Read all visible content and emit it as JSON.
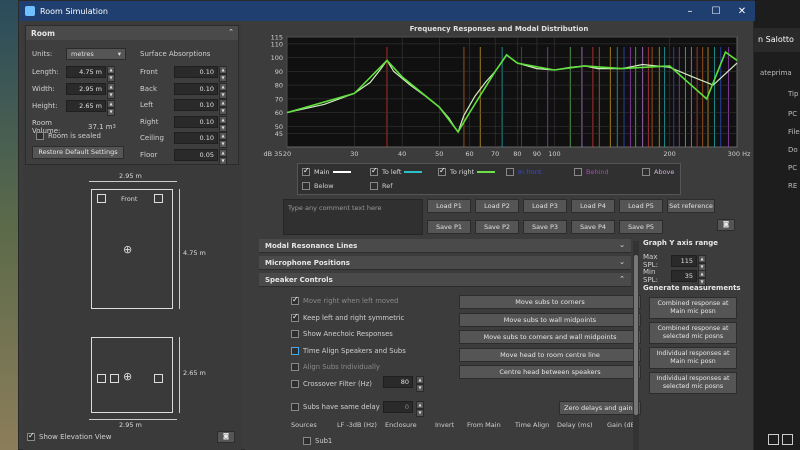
{
  "window": {
    "title": "Room Simulation",
    "buttons": [
      "–",
      "☐",
      "✕"
    ]
  },
  "background_app": {
    "tab": "n Salotto",
    "subtitle": "ateprima",
    "col": "Tip",
    "rows": [
      "PC",
      "File",
      "Do",
      "PC",
      "RE"
    ]
  },
  "room": {
    "section_title": "Room",
    "units_label": "Units:",
    "units_value": "metres",
    "length_label": "Length:",
    "length_value": "4.75 m",
    "width_label": "Width:",
    "width_value": "2.95 m",
    "height_label": "Height:",
    "height_value": "2.65 m",
    "volume_label": "Room Volume:",
    "volume_value": "37.1 m",
    "volume_unit_sup": "3",
    "sealed_label": "Room is sealed",
    "restore_button": "Restore Default Settings",
    "absorptions_title": "Surface Absorptions",
    "surfaces": [
      {
        "label": "Front",
        "value": "0.10"
      },
      {
        "label": "Back",
        "value": "0.10"
      },
      {
        "label": "Left",
        "value": "0.10"
      },
      {
        "label": "Right",
        "value": "0.10"
      },
      {
        "label": "Ceiling",
        "value": "0.10"
      },
      {
        "label": "Floor",
        "value": "0.05"
      }
    ]
  },
  "plan": {
    "top_width": "2.95 m",
    "front_label": "Front",
    "length": "4.75 m",
    "height": "2.65 m",
    "bottom_width": "2.95 m",
    "elevation_label": "Show Elevation View"
  },
  "chart": {
    "title": "Frequency Responses and Modal Distribution",
    "y_unit": "dB 35",
    "x_unit": "300 Hz",
    "y_ticks": [
      "115",
      "110",
      "100",
      "90",
      "80",
      "70",
      "60",
      "50",
      "45"
    ],
    "x_ticks": [
      "20",
      "30",
      "40",
      "50",
      "60",
      "70",
      "80",
      "90",
      "100",
      "200"
    ]
  },
  "chart_data": {
    "type": "line",
    "title": "Frequency Responses and Modal Distribution",
    "xlabel": "Hz",
    "ylabel": "dB",
    "xscale": "log",
    "xlim": [
      20,
      300
    ],
    "ylim": [
      35,
      115
    ],
    "series": [
      {
        "name": "Main",
        "x": [
          20,
          25,
          30,
          33,
          35,
          36.5,
          38,
          42,
          46,
          50,
          53,
          55,
          56,
          58,
          62,
          66,
          70,
          73,
          75,
          80,
          90,
          100,
          110,
          120,
          130,
          150,
          170,
          200,
          230,
          260,
          300
        ],
        "values": [
          60,
          66,
          74,
          82,
          91,
          98,
          90,
          80,
          72,
          64,
          56,
          49,
          46,
          58,
          72,
          82,
          90,
          97,
          102,
          96,
          92,
          91,
          93,
          94,
          92,
          92,
          95,
          93,
          86,
          80,
          96
        ]
      },
      {
        "name": "To right",
        "x": [
          20,
          30,
          36.5,
          40,
          50,
          56,
          60,
          70,
          75,
          80,
          100,
          120,
          150,
          200,
          250,
          280,
          300
        ],
        "values": [
          60,
          74,
          98,
          86,
          64,
          46,
          60,
          90,
          102,
          96,
          91,
          94,
          92,
          94,
          70,
          104,
          98
        ]
      }
    ]
  },
  "legend": {
    "items": [
      {
        "label": "Main",
        "checked": true,
        "color": "#ffffff"
      },
      {
        "label": "To left",
        "checked": true,
        "color": "#29c0c8"
      },
      {
        "label": "To right",
        "checked": true,
        "color": "#6ee04a"
      },
      {
        "label": "In front",
        "checked": false,
        "color": "#3a4ccc"
      },
      {
        "label": "Behind",
        "checked": false,
        "color": "#b040c0"
      },
      {
        "label": "Above",
        "checked": false,
        "color": "#c8b0e0"
      },
      {
        "label": "Below",
        "checked": false,
        "color": "#d0d0d0"
      },
      {
        "label": "Ref",
        "checked": false,
        "color": "#d0d0d0"
      }
    ]
  },
  "comments": {
    "placeholder": "Type any comment text here"
  },
  "load_buttons": [
    "Load P1",
    "Load P2",
    "Load P3",
    "Load P4",
    "Load P5",
    "Set reference"
  ],
  "save_buttons": [
    "Save P1",
    "Save P2",
    "Save P3",
    "Save P4",
    "Save P5"
  ],
  "sections": {
    "modal": "Modal Resonance Lines",
    "mic": "Microphone Positions",
    "speaker": "Speaker Controls"
  },
  "speaker": {
    "options": [
      {
        "label": "Move right when left moved",
        "checked": true,
        "enabled": false
      },
      {
        "label": "Keep left and right symmetric",
        "checked": true,
        "enabled": true
      },
      {
        "label": "Show Anechoic Responses",
        "checked": false,
        "enabled": true
      },
      {
        "label": "Time Align Speakers and Subs",
        "checked": false,
        "enabled": true
      },
      {
        "label": "Align Subs Individually",
        "checked": false,
        "enabled": false
      },
      {
        "label": "Crossover Filter (Hz)",
        "checked": false,
        "enabled": true
      }
    ],
    "crossover_value": "80",
    "subs_delay_label": "Subs have same delay",
    "subs_delay_value": "0",
    "buttons": [
      "Move subs to corners",
      "Move subs to wall midpoints",
      "Move subs to corners and wall midpoints",
      "Move head to room centre line",
      "Centre head between speakers"
    ],
    "zero_button": "Zero delays and gains",
    "columns": [
      "Sources",
      "LF -3dB (Hz)",
      "Enclosure",
      "Invert",
      "From Main",
      "Time Align",
      "Delay (ms)",
      "Gain (dB)"
    ],
    "first_source": "Sub1"
  },
  "yaxis": {
    "title": "Graph Y axis range",
    "max_label": "Max SPL:",
    "max_value": "115",
    "min_label": "Min SPL:",
    "min_value": "35"
  },
  "generate": {
    "title": "Generate measurements",
    "buttons": [
      "Combined response at Main mic posn",
      "Combined response at selected mic posns",
      "Individual responses at Main mic posn",
      "Individual responses at selected mic posns"
    ]
  }
}
